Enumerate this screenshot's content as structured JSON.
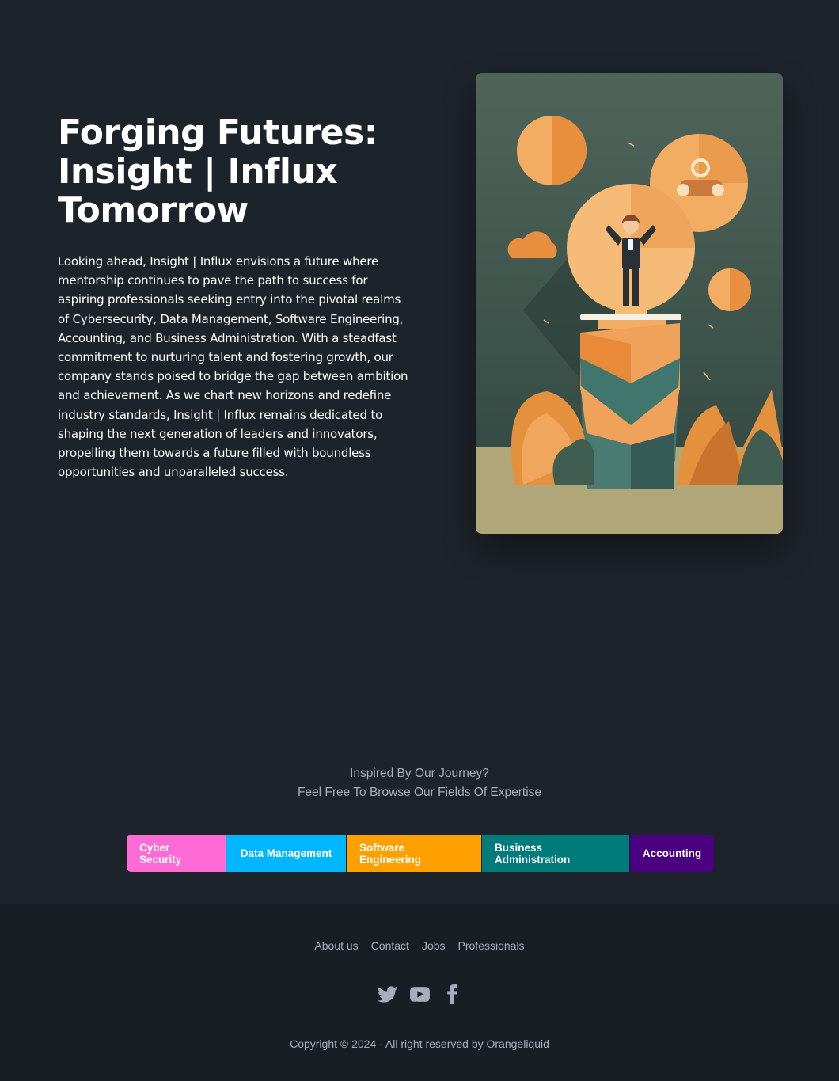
{
  "hero": {
    "title_line1": "Forging Futures:",
    "title_line2": "Insight | Influx",
    "title_line3": "Tomorrow",
    "body": "Looking ahead, Insight | Influx envisions a future where mentorship continues to pave the path to success for aspiring professionals seeking entry into the pivotal realms of Cybersecurity, Data Management, Software Engineering, Accounting, and Business Administration. With a steadfast commitment to nurturing talent and fostering growth, our company stands poised to bridge the gap between ambition and achievement. As we chart new horizons and redefine industry standards, Insight | Influx remains dedicated to shaping the next generation of leaders and innovators, propelling them towards a future filled with boundless opportunities and unparalleled success."
  },
  "cta": {
    "line1": "Inspired By Our Journey?",
    "line2": "Feel Free To Browse Our Fields Of Expertise"
  },
  "fields": [
    {
      "label": "Cyber Security",
      "bg": "#ff6bd5",
      "fg": "#ffffff"
    },
    {
      "label": "Data Management",
      "bg": "#00b6ff",
      "fg": "#ffffff"
    },
    {
      "label": "Software Engineering",
      "bg": "#ff9f00",
      "fg": "#ffffff"
    },
    {
      "label": "Business Administration",
      "bg": "#007b7b",
      "fg": "#ffffff"
    },
    {
      "label": "Accounting",
      "bg": "#4b0082",
      "fg": "#ffffff"
    }
  ],
  "footer": {
    "links": [
      "About us",
      "Contact",
      "Jobs",
      "Professionals"
    ],
    "social_icons": [
      "twitter-icon",
      "youtube-icon",
      "facebook-icon"
    ],
    "copyright": "Copyright © 2024 - All right reserved by Orangeliquid"
  }
}
